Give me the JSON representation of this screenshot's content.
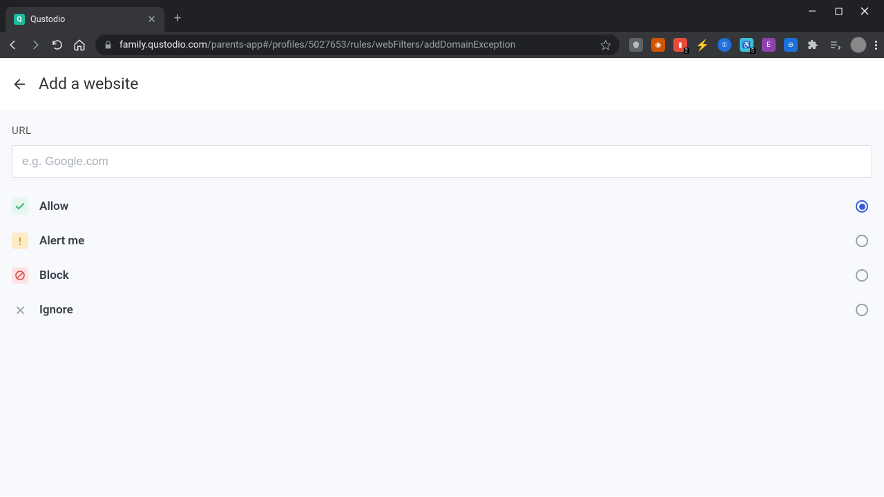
{
  "browser": {
    "tab_title": "Qustodio",
    "url_host": "family.qustodio.com",
    "url_path": "/parents-app#/profiles/5027653/rules/webFilters/addDomainException",
    "ext_badge_1": "2",
    "ext_badge_2": "5"
  },
  "page": {
    "title": "Add a website",
    "url_label": "URL",
    "url_placeholder": "e.g. Google.com",
    "url_value": "",
    "options": {
      "allow": "Allow",
      "alert": "Alert me",
      "block": "Block",
      "ignore": "Ignore"
    },
    "selected": "allow"
  }
}
